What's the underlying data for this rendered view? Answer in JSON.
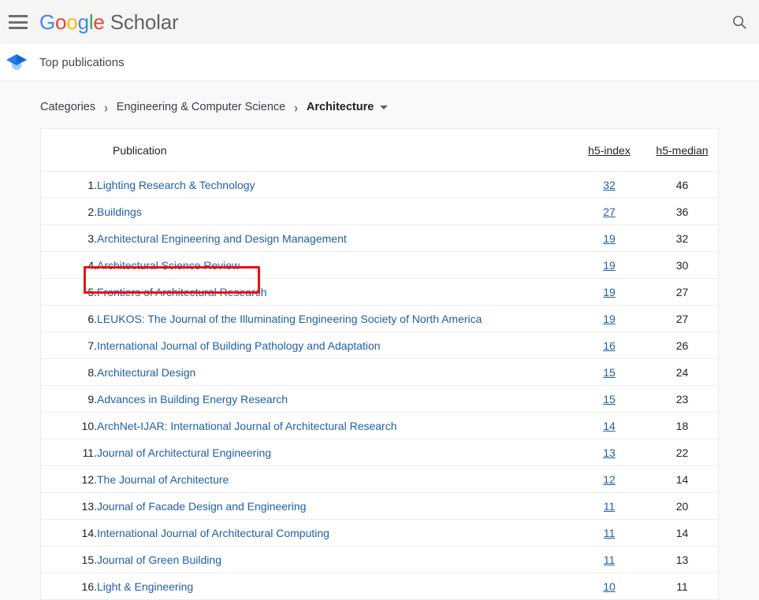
{
  "topbar": {
    "menu_icon": "hamburger-menu-icon",
    "brand": {
      "google": "Google",
      "scholar": "Scholar",
      "letters": [
        "G",
        "o",
        "o",
        "g",
        "l",
        "e"
      ]
    },
    "search_icon": "search-icon"
  },
  "subheader": {
    "icon": "graduation-cap-icon",
    "title": "Top publications"
  },
  "breadcrumb": {
    "items": [
      {
        "label": "Categories",
        "current": false
      },
      {
        "label": "Engineering & Computer Science",
        "current": false
      },
      {
        "label": "Architecture",
        "current": true
      }
    ],
    "separator": "›",
    "caret_icon": "chevron-down-icon"
  },
  "table": {
    "headers": {
      "rank": "",
      "publication": "Publication",
      "h5_index": "h5-index",
      "h5_median": "h5-median"
    },
    "rows": [
      {
        "rank": "1.",
        "publication": "Lighting Research & Technology",
        "h5_index": "32",
        "h5_median": "46"
      },
      {
        "rank": "2.",
        "publication": "Buildings",
        "h5_index": "27",
        "h5_median": "36"
      },
      {
        "rank": "3.",
        "publication": "Architectural Engineering and Design Management",
        "h5_index": "19",
        "h5_median": "32"
      },
      {
        "rank": "4.",
        "publication": "Architectural Science Review",
        "h5_index": "19",
        "h5_median": "30"
      },
      {
        "rank": "5.",
        "publication": "Frontiers of Architectural Research",
        "h5_index": "19",
        "h5_median": "27"
      },
      {
        "rank": "6.",
        "publication": "LEUKOS: The Journal of the Illuminating Engineering Society of North America",
        "h5_index": "19",
        "h5_median": "27"
      },
      {
        "rank": "7.",
        "publication": "International Journal of Building Pathology and Adaptation",
        "h5_index": "16",
        "h5_median": "26"
      },
      {
        "rank": "8.",
        "publication": "Architectural Design",
        "h5_index": "15",
        "h5_median": "24"
      },
      {
        "rank": "9.",
        "publication": "Advances in Building Energy Research",
        "h5_index": "15",
        "h5_median": "23"
      },
      {
        "rank": "10.",
        "publication": "ArchNet-IJAR: International Journal of Architectural Research",
        "h5_index": "14",
        "h5_median": "18"
      },
      {
        "rank": "11.",
        "publication": "Journal of Architectural Engineering",
        "h5_index": "13",
        "h5_median": "22"
      },
      {
        "rank": "12.",
        "publication": "The Journal of Architecture",
        "h5_index": "12",
        "h5_median": "14"
      },
      {
        "rank": "13.",
        "publication": "Journal of Facade Design and Engineering",
        "h5_index": "11",
        "h5_median": "20"
      },
      {
        "rank": "14.",
        "publication": "International Journal of Architectural Computing",
        "h5_index": "11",
        "h5_median": "14"
      },
      {
        "rank": "15.",
        "publication": "Journal of Green Building",
        "h5_index": "11",
        "h5_median": "13"
      },
      {
        "rank": "16.",
        "publication": "Light & Engineering",
        "h5_index": "10",
        "h5_median": "11"
      }
    ]
  },
  "annotation": {
    "highlight_target_row": 5,
    "highlight_color": "#ee1111"
  },
  "colors": {
    "google_blue": "#4285F4",
    "google_red": "#EA4335",
    "google_yellow": "#FBBC05",
    "google_green": "#34A853",
    "link_blue": "#1f5fa8",
    "topbar_bg": "#f5f5f3",
    "page_bg": "#f8f9fa",
    "table_border": "#ececec"
  }
}
